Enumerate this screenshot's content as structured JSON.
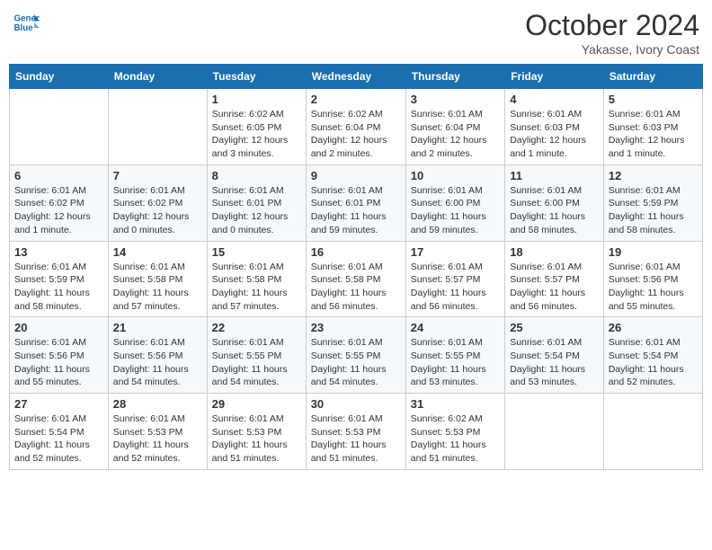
{
  "header": {
    "logo_line1": "General",
    "logo_line2": "Blue",
    "month": "October 2024",
    "location": "Yakasse, Ivory Coast"
  },
  "weekdays": [
    "Sunday",
    "Monday",
    "Tuesday",
    "Wednesday",
    "Thursday",
    "Friday",
    "Saturday"
  ],
  "weeks": [
    [
      {
        "day": "",
        "info": ""
      },
      {
        "day": "",
        "info": ""
      },
      {
        "day": "1",
        "info": "Sunrise: 6:02 AM\nSunset: 6:05 PM\nDaylight: 12 hours and 3 minutes."
      },
      {
        "day": "2",
        "info": "Sunrise: 6:02 AM\nSunset: 6:04 PM\nDaylight: 12 hours and 2 minutes."
      },
      {
        "day": "3",
        "info": "Sunrise: 6:01 AM\nSunset: 6:04 PM\nDaylight: 12 hours and 2 minutes."
      },
      {
        "day": "4",
        "info": "Sunrise: 6:01 AM\nSunset: 6:03 PM\nDaylight: 12 hours and 1 minute."
      },
      {
        "day": "5",
        "info": "Sunrise: 6:01 AM\nSunset: 6:03 PM\nDaylight: 12 hours and 1 minute."
      }
    ],
    [
      {
        "day": "6",
        "info": "Sunrise: 6:01 AM\nSunset: 6:02 PM\nDaylight: 12 hours and 1 minute."
      },
      {
        "day": "7",
        "info": "Sunrise: 6:01 AM\nSunset: 6:02 PM\nDaylight: 12 hours and 0 minutes."
      },
      {
        "day": "8",
        "info": "Sunrise: 6:01 AM\nSunset: 6:01 PM\nDaylight: 12 hours and 0 minutes."
      },
      {
        "day": "9",
        "info": "Sunrise: 6:01 AM\nSunset: 6:01 PM\nDaylight: 11 hours and 59 minutes."
      },
      {
        "day": "10",
        "info": "Sunrise: 6:01 AM\nSunset: 6:00 PM\nDaylight: 11 hours and 59 minutes."
      },
      {
        "day": "11",
        "info": "Sunrise: 6:01 AM\nSunset: 6:00 PM\nDaylight: 11 hours and 58 minutes."
      },
      {
        "day": "12",
        "info": "Sunrise: 6:01 AM\nSunset: 5:59 PM\nDaylight: 11 hours and 58 minutes."
      }
    ],
    [
      {
        "day": "13",
        "info": "Sunrise: 6:01 AM\nSunset: 5:59 PM\nDaylight: 11 hours and 58 minutes."
      },
      {
        "day": "14",
        "info": "Sunrise: 6:01 AM\nSunset: 5:58 PM\nDaylight: 11 hours and 57 minutes."
      },
      {
        "day": "15",
        "info": "Sunrise: 6:01 AM\nSunset: 5:58 PM\nDaylight: 11 hours and 57 minutes."
      },
      {
        "day": "16",
        "info": "Sunrise: 6:01 AM\nSunset: 5:58 PM\nDaylight: 11 hours and 56 minutes."
      },
      {
        "day": "17",
        "info": "Sunrise: 6:01 AM\nSunset: 5:57 PM\nDaylight: 11 hours and 56 minutes."
      },
      {
        "day": "18",
        "info": "Sunrise: 6:01 AM\nSunset: 5:57 PM\nDaylight: 11 hours and 56 minutes."
      },
      {
        "day": "19",
        "info": "Sunrise: 6:01 AM\nSunset: 5:56 PM\nDaylight: 11 hours and 55 minutes."
      }
    ],
    [
      {
        "day": "20",
        "info": "Sunrise: 6:01 AM\nSunset: 5:56 PM\nDaylight: 11 hours and 55 minutes."
      },
      {
        "day": "21",
        "info": "Sunrise: 6:01 AM\nSunset: 5:56 PM\nDaylight: 11 hours and 54 minutes."
      },
      {
        "day": "22",
        "info": "Sunrise: 6:01 AM\nSunset: 5:55 PM\nDaylight: 11 hours and 54 minutes."
      },
      {
        "day": "23",
        "info": "Sunrise: 6:01 AM\nSunset: 5:55 PM\nDaylight: 11 hours and 54 minutes."
      },
      {
        "day": "24",
        "info": "Sunrise: 6:01 AM\nSunset: 5:55 PM\nDaylight: 11 hours and 53 minutes."
      },
      {
        "day": "25",
        "info": "Sunrise: 6:01 AM\nSunset: 5:54 PM\nDaylight: 11 hours and 53 minutes."
      },
      {
        "day": "26",
        "info": "Sunrise: 6:01 AM\nSunset: 5:54 PM\nDaylight: 11 hours and 52 minutes."
      }
    ],
    [
      {
        "day": "27",
        "info": "Sunrise: 6:01 AM\nSunset: 5:54 PM\nDaylight: 11 hours and 52 minutes."
      },
      {
        "day": "28",
        "info": "Sunrise: 6:01 AM\nSunset: 5:53 PM\nDaylight: 11 hours and 52 minutes."
      },
      {
        "day": "29",
        "info": "Sunrise: 6:01 AM\nSunset: 5:53 PM\nDaylight: 11 hours and 51 minutes."
      },
      {
        "day": "30",
        "info": "Sunrise: 6:01 AM\nSunset: 5:53 PM\nDaylight: 11 hours and 51 minutes."
      },
      {
        "day": "31",
        "info": "Sunrise: 6:02 AM\nSunset: 5:53 PM\nDaylight: 11 hours and 51 minutes."
      },
      {
        "day": "",
        "info": ""
      },
      {
        "day": "",
        "info": ""
      }
    ]
  ]
}
